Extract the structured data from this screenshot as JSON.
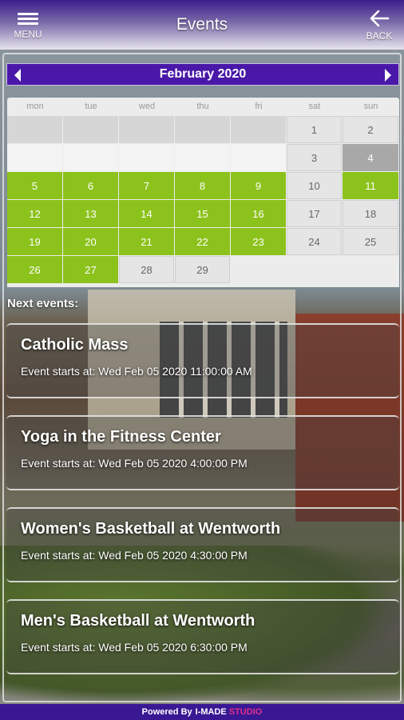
{
  "header": {
    "title": "Events",
    "menu_label": "MENU",
    "back_label": "BACK"
  },
  "calendar": {
    "month_title": "February 2020",
    "weekdays": [
      "mon",
      "tue",
      "wed",
      "thu",
      "fri",
      "sat",
      "sun"
    ],
    "days_in_month": 29,
    "first_weekday_index": 5,
    "event_days": [
      5,
      6,
      7,
      8,
      9,
      11,
      12,
      13,
      14,
      15,
      16,
      19,
      20,
      21,
      22,
      23,
      26,
      27
    ],
    "today": 4,
    "colors": {
      "event": "#8cc21c",
      "today": "#a8a8a8",
      "default": "#e5e5e5",
      "month_bar": "#4a18a8"
    }
  },
  "next_events": {
    "label": "Next events:",
    "items": [
      {
        "title": "Catholic Mass",
        "time": "Event starts at: Wed Feb 05 2020 11:00:00 AM"
      },
      {
        "title": "Yoga in the Fitness Center",
        "time": "Event starts at: Wed Feb 05 2020 4:00:00 PM"
      },
      {
        "title": "Women's Basketball at Wentworth",
        "time": "Event starts at: Wed Feb 05 2020 4:30:00 PM"
      },
      {
        "title": "Men's Basketball at Wentworth",
        "time": "Event starts at: Wed Feb 05 2020 6:30:00 PM"
      }
    ]
  },
  "footer": {
    "powered_by": "Powered By",
    "brand": "I-MADE",
    "studio": "STUDIO"
  }
}
